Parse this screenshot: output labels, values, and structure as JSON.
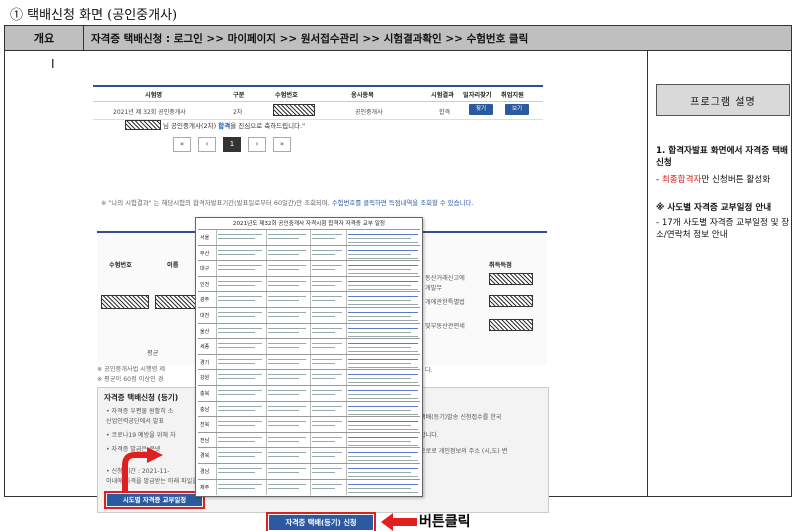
{
  "page_heading": "① 택배신청 화면 (공인중개사)",
  "header": {
    "label": "개요",
    "path": "자격증 택배신청 : 로그인 >> 마이페이지 >> 원서접수관리 >> 시험결과확인 >> 수험번호 클릭"
  },
  "left": {
    "cursor_mark": "I",
    "results_table": {
      "columns": [
        "시험명",
        "구분",
        "수험번호",
        "응시종목",
        "시험결과",
        "일자리찾기",
        "취업지원"
      ],
      "row": {
        "exam": "2021년 제 32회 공인중개사",
        "part": "2차",
        "subject": "공인중개사",
        "result": "합격",
        "btn_find": "찾기",
        "btn_support": "보기"
      }
    },
    "congrats": {
      "prefix": "님 공인중개사(2차)",
      "highlight": "합격",
      "suffix": "을 진심으로 축하드립니다.\""
    },
    "pager": [
      "«",
      "‹",
      "1",
      "›",
      "»"
    ],
    "note": {
      "text": "※ \"나의 시험결과\" 는 해당시험의 합격자발표기간(발표일로부터 60일간)만 조회되며,",
      "link": "수험번호를 클릭하면 득점내역을 조회할 수 있습니다."
    },
    "score_table": {
      "col_examno": "수험번호",
      "col_name": "이름",
      "col_bonus": "취득득점",
      "avg": "평균",
      "frag1": "동산거래신고에",
      "frag2": "개발무",
      "frag3": "개에관한특별법",
      "frag4": "및부동산관련세"
    },
    "notes_below": [
      "※ 공인중개사법 시행령 제",
      "※ 평균이 60점 이상인 경"
    ],
    "tail_frag": "다.",
    "section2": {
      "title": "자격증 택배신청 (등기)",
      "bullets": [
        "• 자격증 우편물 원활히 소",
        "  산업인력공단에서 발표",
        "• 코로나19 예방을 위해 자",
        "• 자격증 발급은 큰넷",
        "• 신청 기간 : 2021-11-",
        "  이내에 자격을 발급받는 아래 파일을 참고하여 주시기 바랍니다."
      ],
      "right_frags": [
        "택배(등기)발송 신청접수를 한국",
        "합니다.",
        "으로로 개인정보의 주소 (시,도) 변"
      ],
      "schedule_btn": "시도별 자격증 교부일정"
    },
    "popup": {
      "title": "2021년도 제32회 공인중개사 자격시험 합격자 자격증 교부 일정",
      "regions": [
        "서울",
        "부산",
        "대구",
        "인천",
        "광주",
        "대전",
        "울산",
        "세종",
        "경기",
        "강원",
        "충북",
        "충남",
        "전북",
        "전남",
        "경북",
        "경남",
        "제주"
      ]
    },
    "apply_btn": "자격증 택배(등기) 신청",
    "click_label": "버튼클릭"
  },
  "right": {
    "title": "프로그램 설명",
    "item1_title": "1. 합격자발표 화면에서 자격증 택배 신청",
    "item1_sub_prefix": "- ",
    "item1_sub_red": "최종합격자",
    "item1_sub_rest": "만 신청버튼 활성화",
    "item2_title": "※ 사도별 자격증 교부일정 안내",
    "item2_sub": "- 17개 사도별 자격증 교부일정 및 장소/연락처 정보 안내"
  },
  "colors": {
    "accent_blue": "#2c5aa0",
    "highlight_red": "#e02020",
    "header_gray": "#bfbfbf"
  }
}
